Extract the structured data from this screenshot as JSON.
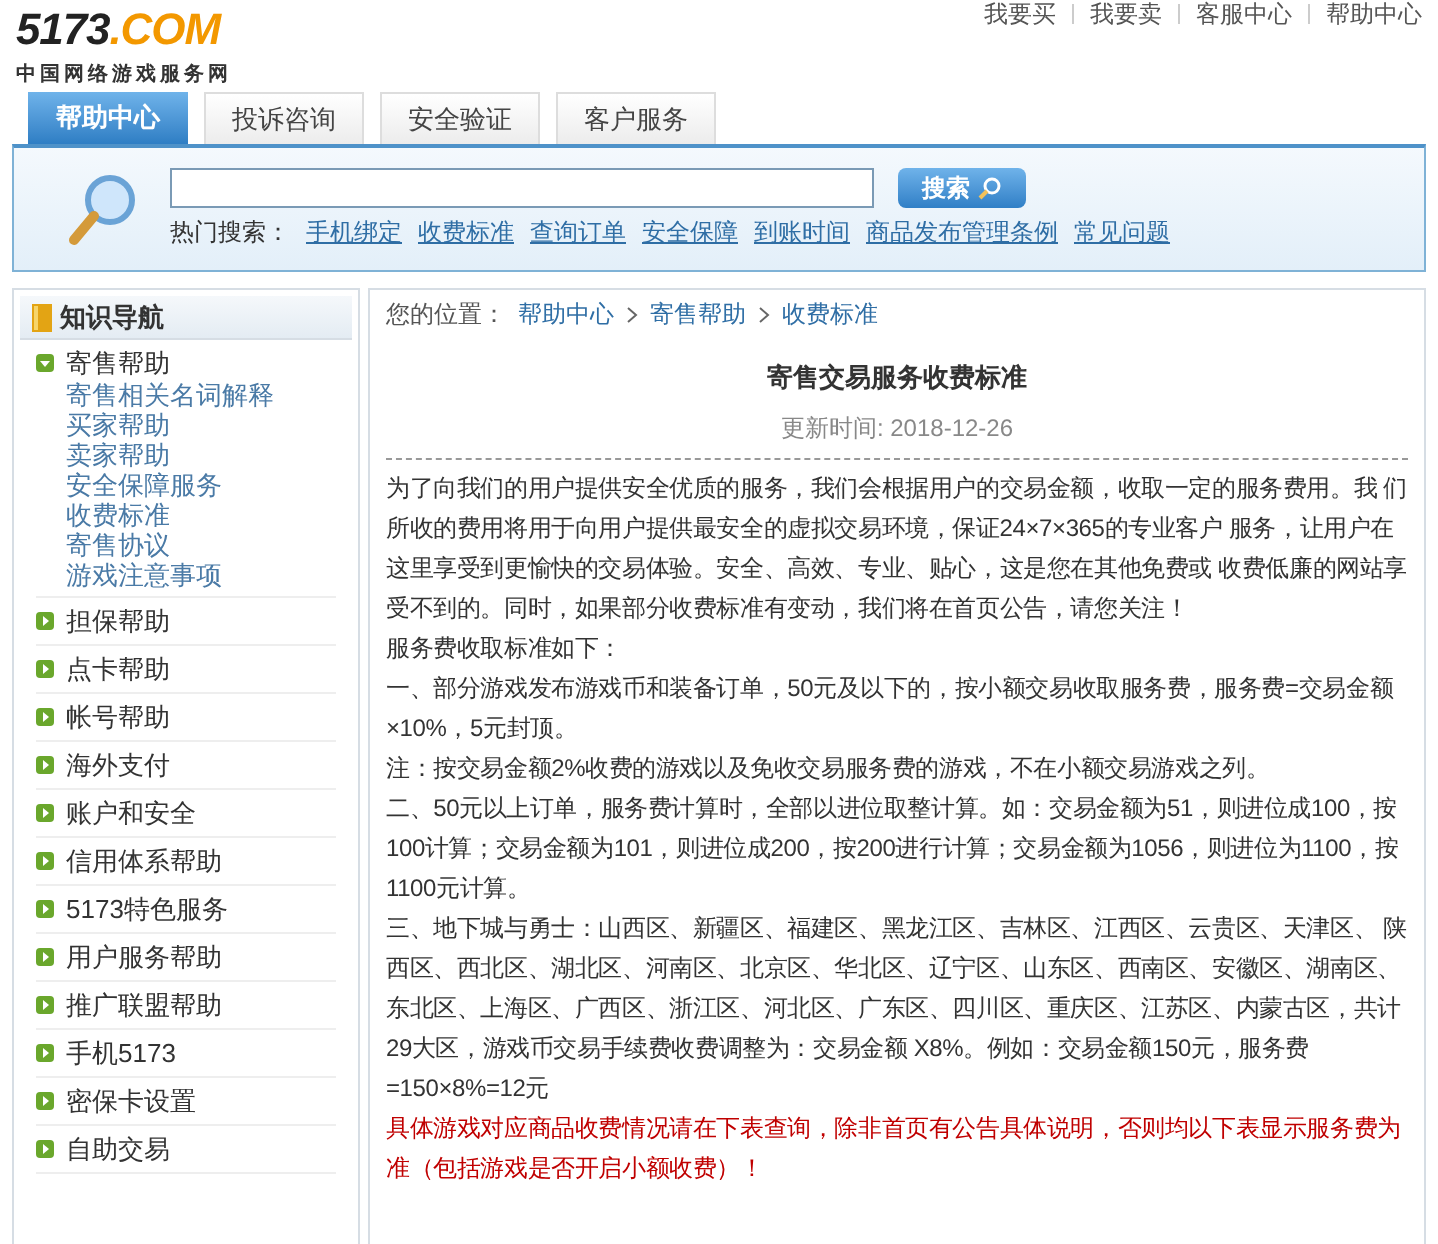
{
  "logo": {
    "brand": "5173.COM",
    "tagline": "中国网络游戏服务网"
  },
  "top_links": [
    "我要买",
    "我要卖",
    "客服中心",
    "帮助中心"
  ],
  "tabs": [
    {
      "label": "帮助中心",
      "selected": true
    },
    {
      "label": "投诉咨询",
      "selected": false
    },
    {
      "label": "安全验证",
      "selected": false
    },
    {
      "label": "客户服务",
      "selected": false
    }
  ],
  "search": {
    "button": "搜索",
    "hot_label": "热门搜索：",
    "hot_links": [
      "手机绑定",
      "收费标准",
      "查询订单",
      "安全保障",
      "到账时间",
      "商品发布管理条例",
      "常见问题"
    ]
  },
  "sidebar": {
    "title": "知识导航",
    "items": [
      {
        "label": "寄售帮助",
        "expanded": true,
        "children": [
          "寄售相关名词解释",
          "买家帮助",
          "卖家帮助",
          "安全保障服务",
          "收费标准",
          "寄售协议",
          "游戏注意事项"
        ]
      },
      {
        "label": "担保帮助",
        "expanded": false
      },
      {
        "label": "点卡帮助",
        "expanded": false
      },
      {
        "label": "帐号帮助",
        "expanded": false
      },
      {
        "label": "海外支付",
        "expanded": false
      },
      {
        "label": "账户和安全",
        "expanded": false
      },
      {
        "label": "信用体系帮助",
        "expanded": false
      },
      {
        "label": "5173特色服务",
        "expanded": false
      },
      {
        "label": "用户服务帮助",
        "expanded": false
      },
      {
        "label": "推广联盟帮助",
        "expanded": false
      },
      {
        "label": "手机5173",
        "expanded": false
      },
      {
        "label": "密保卡设置",
        "expanded": false
      },
      {
        "label": "自助交易",
        "expanded": false
      }
    ]
  },
  "breadcrumb": {
    "label": "您的位置：",
    "path": [
      "帮助中心",
      "寄售帮助",
      "收费标准"
    ]
  },
  "article": {
    "title": "寄售交易服务收费标准",
    "updated": "更新时间: 2018-12-26",
    "paragraphs": [
      {
        "kind": "normal",
        "text": "为了向我们的用户提供安全优质的服务，我们会根据用户的交易金额，收取一定的服务费用。我 们所收的费用将用于向用户提供最安全的虚拟交易环境，保证24×7×365的专业客户 服务，让用户在这里享受到更愉快的交易体验。安全、高效、专业、贴心，这是您在其他免费或 收费低廉的网站享受不到的。同时，如果部分收费标准有变动，我们将在首页公告，请您关注！"
      },
      {
        "kind": "normal",
        "text": "服务费收取标准如下："
      },
      {
        "kind": "normal",
        "text": "一、部分游戏发布游戏币和装备订单，50元及以下的，按小额交易收取服务费，服务费=交易金额 ×10%，5元封顶。"
      },
      {
        "kind": "normal",
        "text": "注：按交易金额2%收费的游戏以及免收交易服务费的游戏，不在小额交易游戏之列。"
      },
      {
        "kind": "normal",
        "text": "二、50元以上订单，服务费计算时，全部以进位取整计算。如：交易金额为51，则进位成100，按 100计算；交易金额为101，则进位成200，按200进行计算；交易金额为1056，则进位为1100，按 1100元计算。"
      },
      {
        "kind": "normal",
        "text": "三、地下城与勇士：山西区、新疆区、福建区、黑龙江区、吉林区、江西区、云贵区、天津区、 陕西区、西北区、湖北区、河南区、北京区、华北区、辽宁区、山东区、西南区、安徽区、湖南区、东北区、上海区、广西区、浙江区、河北区、广东区、四川区、重庆区、江苏区、内蒙古区，共计29大区，游戏币交易手续费收费调整为：交易金额 X8%。例如：交易金额150元，服务费=150×8%=12元"
      },
      {
        "kind": "notice",
        "text": "具体游戏对应商品收费情况请在下表查询，除非首页有公告具体说明，否则均以下表显示服务费为准（包括游戏是否开启小额收费）！"
      }
    ]
  }
}
